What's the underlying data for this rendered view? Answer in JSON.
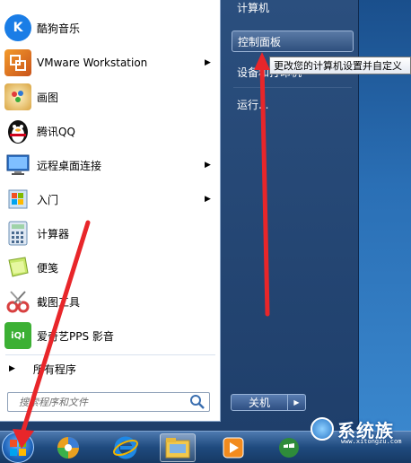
{
  "start_menu": {
    "programs": [
      {
        "label": "酷狗音乐",
        "icon": "kugou-icon",
        "has_submenu": false,
        "color": "#1a7de6"
      },
      {
        "label": "VMware Workstation",
        "icon": "vmware-icon",
        "has_submenu": true,
        "color": "#e07a1a"
      },
      {
        "label": "画图",
        "icon": "paint-icon",
        "has_submenu": false,
        "color": "#4a90d9"
      },
      {
        "label": "腾讯QQ",
        "icon": "qq-penguin-icon",
        "has_submenu": false,
        "color": "#111111"
      },
      {
        "label": "远程桌面连接",
        "icon": "remote-desktop-icon",
        "has_submenu": true,
        "color": "#2f73c8"
      },
      {
        "label": "入门",
        "icon": "getting-started-icon",
        "has_submenu": true,
        "color": "#5da13a"
      },
      {
        "label": "计算器",
        "icon": "calculator-icon",
        "has_submenu": false,
        "color": "#6b8fb5"
      },
      {
        "label": "便笺",
        "icon": "sticky-notes-icon",
        "has_submenu": false,
        "color": "#9acd32"
      },
      {
        "label": "截图工具",
        "icon": "snipping-tool-icon",
        "has_submenu": false,
        "color": "#d84040"
      },
      {
        "label": "爱奇艺PPS 影音",
        "icon": "iqiyi-icon",
        "has_submenu": false,
        "color": "#3cb034"
      }
    ],
    "all_programs_label": "所有程序",
    "search_placeholder": "搜索程序和文件"
  },
  "right_panel": {
    "items": [
      {
        "label": "计算机"
      },
      {
        "label": "控制面板"
      },
      {
        "label": "设备和打印机"
      },
      {
        "label": "运行..."
      }
    ],
    "shutdown_label": "关机"
  },
  "tooltip": "更改您的计算机设置并自定义",
  "taskbar": {
    "icons": [
      "start-orb-icon",
      "ball-icon",
      "ie-icon",
      "explorer-folder-icon",
      "media-player-icon",
      "windows-icon"
    ]
  },
  "watermark": {
    "text": "系统族",
    "sub": "www.xitongzu.com"
  },
  "colors": {
    "menu_bg": "#2b4f7e",
    "accent_red": "#e8262a",
    "taskbar": "#1f4a7e"
  }
}
